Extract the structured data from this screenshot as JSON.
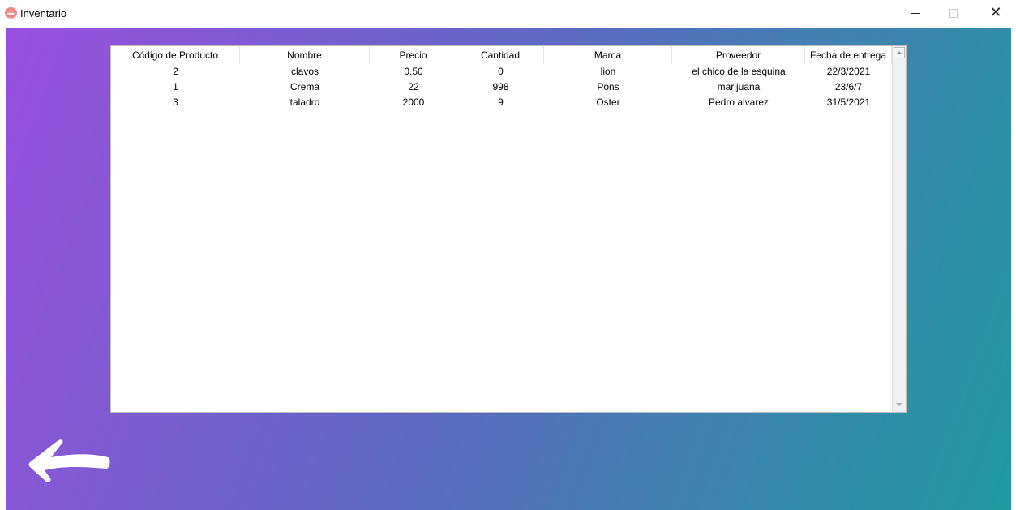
{
  "window": {
    "title": "Inventario",
    "icon": "app-icon",
    "minimize_icon": "minimize-icon",
    "maximize_icon": "maximize-icon",
    "close_icon": "close-icon"
  },
  "colors": {
    "gradient_start": "#9a4fe0",
    "gradient_end": "#1f9aa0",
    "table_bg": "#ffffff"
  },
  "table": {
    "columns": [
      "Código de Producto",
      "Nombre",
      "Precio",
      "Cantidad",
      "Marca",
      "Proveedor",
      "Fecha de entrega"
    ],
    "rows": [
      [
        "2",
        "clavos",
        "0.50",
        "0",
        "lion",
        "el chico de la esquina",
        "22/3/2021"
      ],
      [
        "1",
        "Crema",
        "22",
        "998",
        "Pons",
        "marijuana",
        "23/6/7"
      ],
      [
        "3",
        "taladro",
        "2000",
        "9",
        "Oster",
        "Pedro alvarez",
        "31/5/2021"
      ]
    ]
  },
  "back_button": {
    "icon": "back-arrow-icon"
  }
}
